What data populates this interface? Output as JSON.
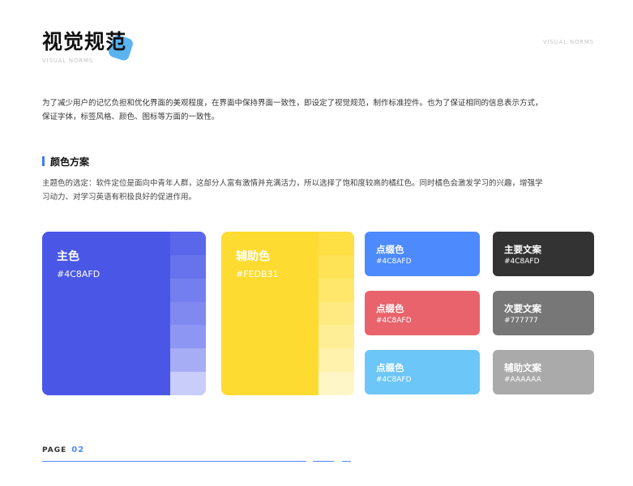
{
  "header": {
    "title": "视觉规范",
    "subtitle": "VISUAL NORMS",
    "top_right": "VISUAL NORMS"
  },
  "intro": "为了减少用户的记忆负担和优化界面的美观程度，在界面中保持界面一致性，即设定了视觉规范，制作标准控件。也为了保证相同的信息表示方式，保证字体，标签风格、颜色、图标等方面的一致性。",
  "section": {
    "title": "颜色方案",
    "description": "主题色的选定：软件定位是面向中青年人群，这部分人富有激情并充满活力，所以选择了饱和度较高的橘红色。同时橘色会激发学习的兴趣，增强学习动力、对学习英语有积极良好的促进作用。"
  },
  "primary": {
    "name": "主色",
    "hex": "#4C8AFD",
    "color": "#4a57e6",
    "tints": [
      "#5a67ea",
      "#6673ec",
      "#737fee",
      "#8089f0",
      "#8d96f2",
      "#a6adf5",
      "#c8cdfa"
    ]
  },
  "secondary": {
    "name": "辅助色",
    "hex": "#FEDB31",
    "color": "#fedb31",
    "tints": [
      "#fedf44",
      "#fee357",
      "#fee76b",
      "#feea80",
      "#feee95",
      "#fff2ac",
      "#fff6c8"
    ]
  },
  "accents": [
    {
      "name": "点缀色",
      "hex": "#4C8AFD",
      "color": "#4c8afd"
    },
    {
      "name": "点缀色",
      "hex": "#4C8AFD",
      "color": "#e9636c"
    },
    {
      "name": "点缀色",
      "hex": "#4C8AFD",
      "color": "#6cc6f7"
    }
  ],
  "text_colors": [
    {
      "name": "主要文案",
      "hex": "#4C8AFD",
      "color": "#333333"
    },
    {
      "name": "次要文案",
      "hex": "#777777",
      "color": "#777777"
    },
    {
      "name": "辅助文案",
      "hex": "#AAAAAA",
      "color": "#aaaaaa"
    }
  ],
  "footer": {
    "label": "PAGE",
    "page": "02"
  },
  "accent_line_color": "#4c8afd"
}
